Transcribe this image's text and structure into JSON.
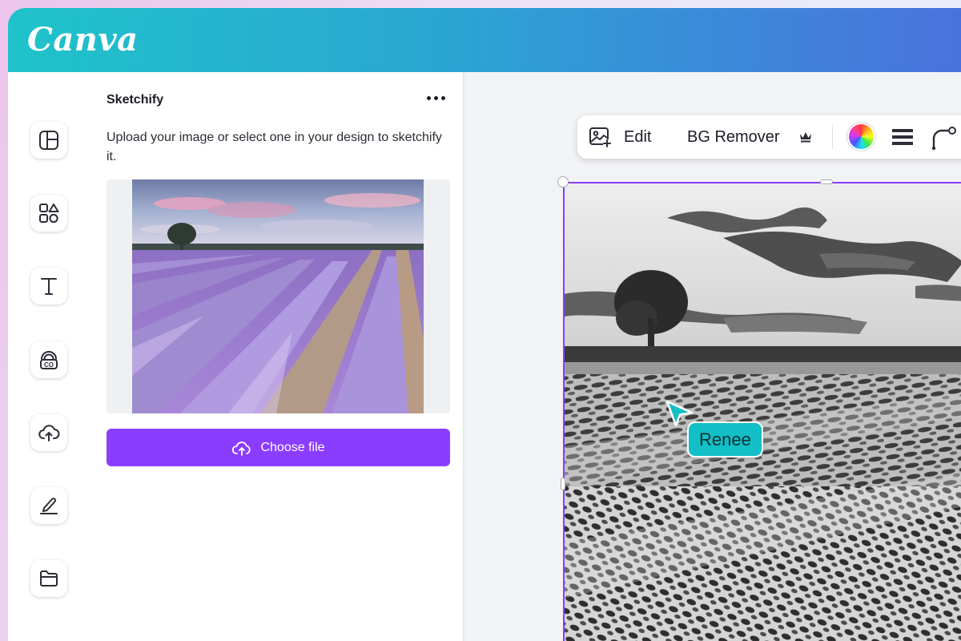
{
  "app": {
    "logo_text": "Canva"
  },
  "colors": {
    "accent": "#8b3dff",
    "header_start": "#1fc3c9",
    "header_end": "#4a72de",
    "collab": "#13bfc6"
  },
  "sidebar": {
    "items": [
      {
        "icon": "layout-icon"
      },
      {
        "icon": "elements-icon"
      },
      {
        "icon": "text-icon"
      },
      {
        "icon": "brand-icon"
      },
      {
        "icon": "upload-icon"
      },
      {
        "icon": "draw-icon"
      },
      {
        "icon": "folder-icon"
      }
    ]
  },
  "panel": {
    "title": "Sketchify",
    "description": "Upload your image or select one in your design to sketchify it.",
    "choose_label": "Choose file"
  },
  "toolbar": {
    "edit_label": "Edit",
    "bg_remover_label": "BG Remover"
  },
  "collaborator": {
    "name": "Renee"
  }
}
